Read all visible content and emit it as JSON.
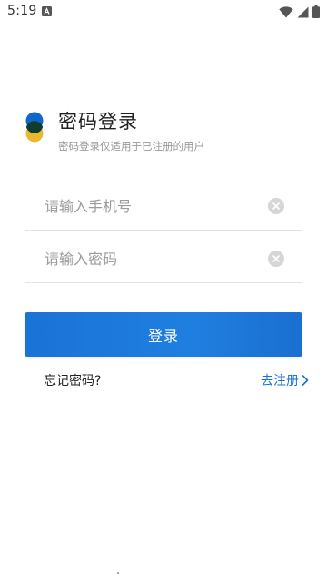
{
  "status_bar": {
    "time": "5:19",
    "icons": [
      "a-notification-icon",
      "wifi-icon",
      "signal-icon",
      "battery-icon"
    ]
  },
  "header": {
    "title": "密码登录",
    "subtitle": "密码登录仅适用于已注册的用户",
    "logo_colors": {
      "top": "#1166cc",
      "bottom": "#e8b92e",
      "overlap": "#0f3d2e"
    }
  },
  "form": {
    "phone": {
      "placeholder": "请输入手机号",
      "value": ""
    },
    "password": {
      "placeholder": "请输入密码",
      "value": ""
    },
    "login_label": "登录",
    "forgot_label": "忘记密码?",
    "register_label": "去注册"
  },
  "colors": {
    "accent": "#1a73d6",
    "button_text": "#ffffff",
    "divider": "#e3e3e3",
    "placeholder": "#9b9b9b"
  }
}
